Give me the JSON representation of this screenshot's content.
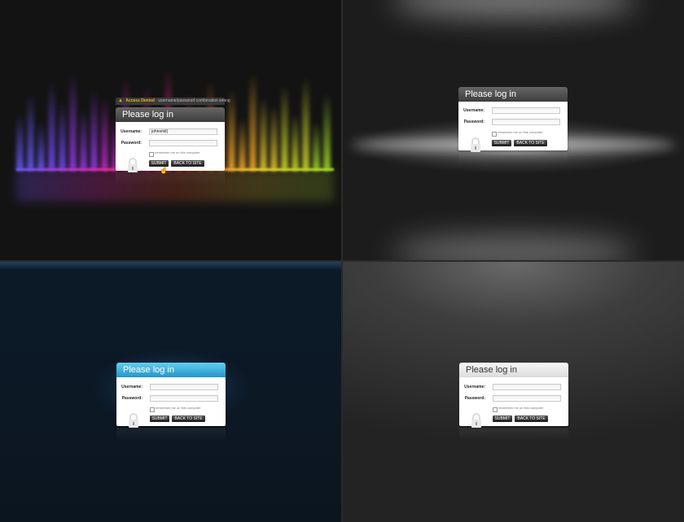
{
  "colors": {
    "alert": "#f2b21a",
    "blue_header": "#2296c8",
    "dark_header": "#3d3d3d",
    "light_header": "#dcdcdc"
  },
  "alert": {
    "icon": "warning-icon",
    "title": "Access Denied",
    "message": "username/password combination wrong"
  },
  "panels": [
    {
      "variant": "spectrum",
      "title": "Please log in",
      "username_label": "Username:",
      "password_label": "Password:",
      "username_value": "johnsmit|",
      "password_value": "",
      "remember_label": "remember me on this computer",
      "submit_label": "SUBMIT",
      "back_label": "BACK TO SITE",
      "lock_icon": "padlock-icon"
    },
    {
      "variant": "dark-glow",
      "title": "Please log in",
      "username_label": "Username:",
      "password_label": "Password:",
      "username_value": "",
      "password_value": "",
      "remember_label": "remember me on this computer",
      "submit_label": "SUBMIT",
      "back_label": "BACK TO SITE",
      "lock_icon": "padlock-icon"
    },
    {
      "variant": "blue",
      "title": "Please log in",
      "username_label": "Username:",
      "password_label": "Password:",
      "username_value": "",
      "password_value": "",
      "remember_label": "remember me on this computer",
      "submit_label": "SUBMIT",
      "back_label": "BACK TO SITE",
      "lock_icon": "padlock-icon"
    },
    {
      "variant": "light",
      "title": "Please log in",
      "username_label": "Username:",
      "password_label": "Password:",
      "username_value": "",
      "password_value": "",
      "remember_label": "remember me on this computer",
      "submit_label": "SUBMIT",
      "back_label": "BACK TO SITE",
      "lock_icon": "padlock-icon"
    }
  ]
}
